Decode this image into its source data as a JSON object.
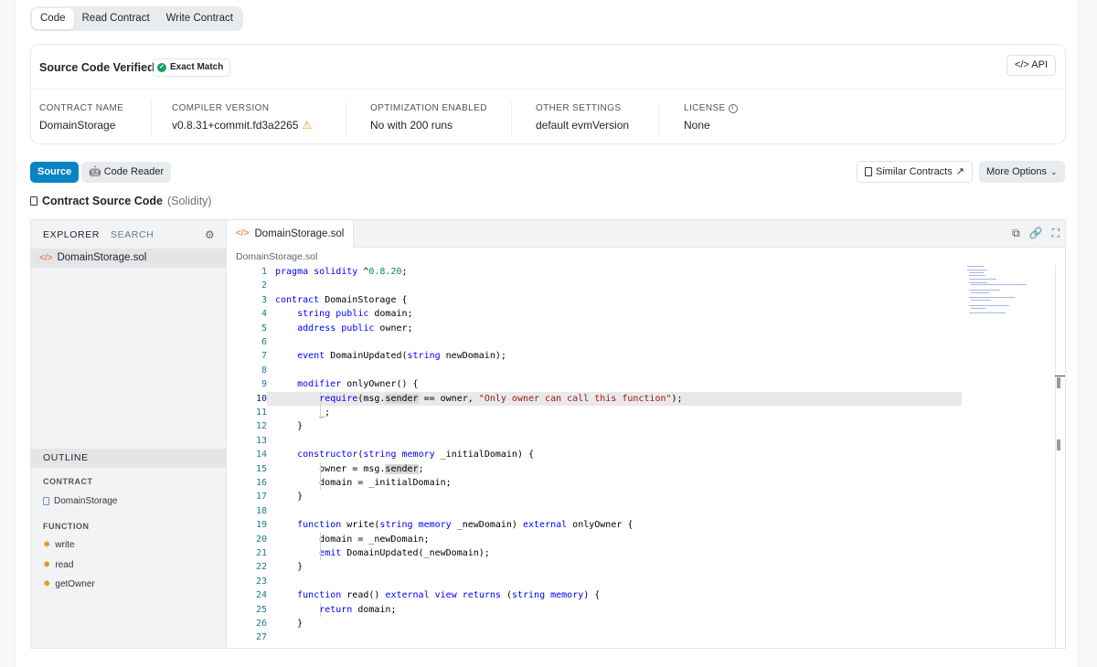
{
  "tabs": [
    {
      "label": "Code",
      "active": true
    },
    {
      "label": "Read Contract",
      "active": false
    },
    {
      "label": "Write Contract",
      "active": false
    }
  ],
  "verified": {
    "title": "Source Code Verified",
    "badge": "Exact Match",
    "api_label": "API",
    "api_icon": "code-icon",
    "fields": [
      {
        "label": "CONTRACT NAME",
        "value": "DomainStorage"
      },
      {
        "label": "COMPILER VERSION",
        "value": "v0.8.31+commit.fd3a2265",
        "warning_icon": "warning-icon"
      },
      {
        "label": "OPTIMIZATION ENABLED",
        "value": "No with 200 runs"
      },
      {
        "label": "OTHER SETTINGS",
        "value": "default evmVersion"
      },
      {
        "label": "LICENSE",
        "value": "None",
        "info_icon": "info-icon"
      }
    ]
  },
  "toolbar": {
    "source_label": "Source",
    "reader_label": "Code Reader",
    "similar_label": "Similar Contracts",
    "more_label": "More Options",
    "section_title": "Contract Source Code",
    "section_lang": "(Solidity)"
  },
  "explorer": {
    "explorer_label": "EXPLORER",
    "search_label": "SEARCH",
    "file": "DomainStorage.sol",
    "outline_label": "OUTLINE",
    "contract_section": "CONTRACT",
    "contract_item": "DomainStorage",
    "function_section": "FUNCTION",
    "functions": [
      "write",
      "read",
      "getOwner"
    ]
  },
  "editor": {
    "tab": "DomainStorage.sol",
    "breadcrumb": "DomainStorage.sol",
    "current_line": 10,
    "lines": [
      "pragma solidity ^0.8.20;",
      "",
      "contract DomainStorage {",
      "    string public domain;",
      "    address public owner;",
      "",
      "    event DomainUpdated(string newDomain);",
      "",
      "    modifier onlyOwner() {",
      "        require(msg.sender == owner, \"Only owner can call this function\");",
      "        _;",
      "    }",
      "",
      "    constructor(string memory _initialDomain) {",
      "        owner = msg.sender;",
      "        domain = _initialDomain;",
      "    }",
      "",
      "    function write(string memory _newDomain) external onlyOwner {",
      "        domain = _newDomain;",
      "        emit DomainUpdated(_newDomain);",
      "    }",
      "",
      "    function read() external view returns (string memory) {",
      "        return domain;",
      "    }",
      ""
    ]
  },
  "colors": {
    "accent": "#0784c3",
    "success": "#1aa062",
    "warning": "#e0a100",
    "keyword": "#0000ff",
    "string": "#a31515",
    "line_number": "#237893"
  }
}
